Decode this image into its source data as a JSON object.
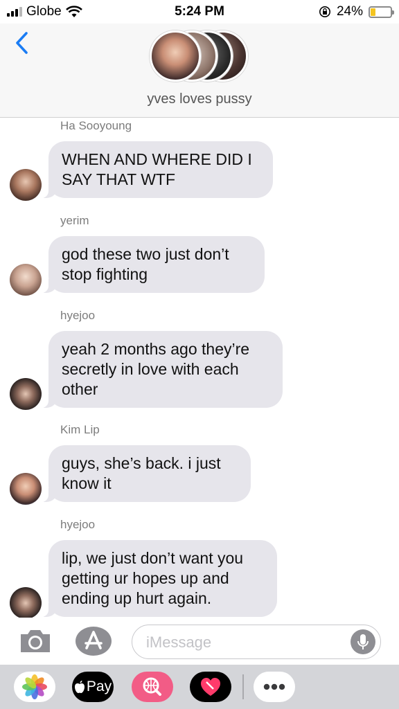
{
  "status_bar": {
    "carrier": "Globe",
    "time": "5:24 PM",
    "battery_percent": "24%",
    "battery_level": 0.24,
    "icons": [
      "signal-icon",
      "wifi-icon",
      "orientation-lock-icon",
      "battery-icon"
    ]
  },
  "header": {
    "group_name": "yves loves pussy"
  },
  "messages": [
    {
      "sender": "Ha Sooyoung",
      "line1": "WHEN AND WHERE DID I",
      "line2": "SAY THAT WTF",
      "line3": ""
    },
    {
      "sender": "yerim",
      "line1": "god these two just don’t",
      "line2": "stop fighting",
      "line3": ""
    },
    {
      "sender": "hyejoo",
      "line1": "yeah 2 months ago they’re",
      "line2": "secretly in love with each",
      "line3": "other"
    },
    {
      "sender": "Kim Lip",
      "line1": "guys, she’s back. i just",
      "line2": "know it",
      "line3": ""
    },
    {
      "sender": "hyejoo",
      "line1": "lip, we just don’t want you",
      "line2": "getting ur hopes up and",
      "line3": "ending up hurt again."
    }
  ],
  "composer": {
    "placeholder": "iMessage"
  },
  "app_drawer": {
    "pay_label": "Pay",
    "apps": [
      "photos-app-icon",
      "apple-pay-icon",
      "image-search-icon",
      "digital-touch-icon",
      "more-apps-icon"
    ]
  },
  "colors": {
    "accent": "#1a7cf4",
    "bubble": "#e6e5eb",
    "drawer": "#d4d5d9",
    "battery_fill": "#f4c420"
  }
}
